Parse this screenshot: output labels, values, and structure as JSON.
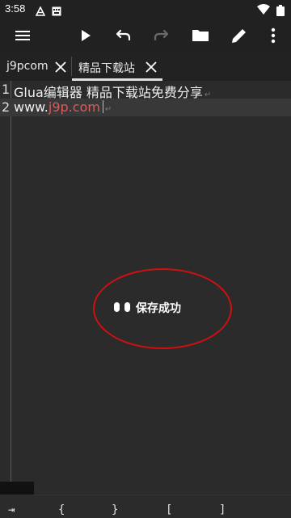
{
  "status_bar": {
    "time": "3:58",
    "notification_icons": [
      "android-notification-icon",
      "keyboard-notification-icon"
    ],
    "wifi": "wifi-icon",
    "battery": "battery-icon"
  },
  "toolbar": {
    "buttons": [
      "menu",
      "run",
      "undo",
      "redo",
      "open-folder",
      "edit",
      "more"
    ],
    "redo_disabled": true
  },
  "tabs": [
    {
      "label": "j9pcom",
      "active": false
    },
    {
      "label": "精品下载站",
      "active": true
    }
  ],
  "editor": {
    "lines": [
      {
        "number": "1",
        "text": "Glua编辑器 精品下载站免费分享",
        "eol": "↵"
      },
      {
        "number": "2",
        "text_prefix": "www.",
        "text_link": "j9p.com",
        "eol": "↵"
      }
    ],
    "current_line": 2,
    "link_color": "#d65c5c"
  },
  "toast": {
    "message": "保存成功",
    "highlight_color": "#d01010"
  },
  "symbol_bar": {
    "symbols": [
      "⇥",
      "{",
      "}",
      "[",
      "]"
    ]
  }
}
